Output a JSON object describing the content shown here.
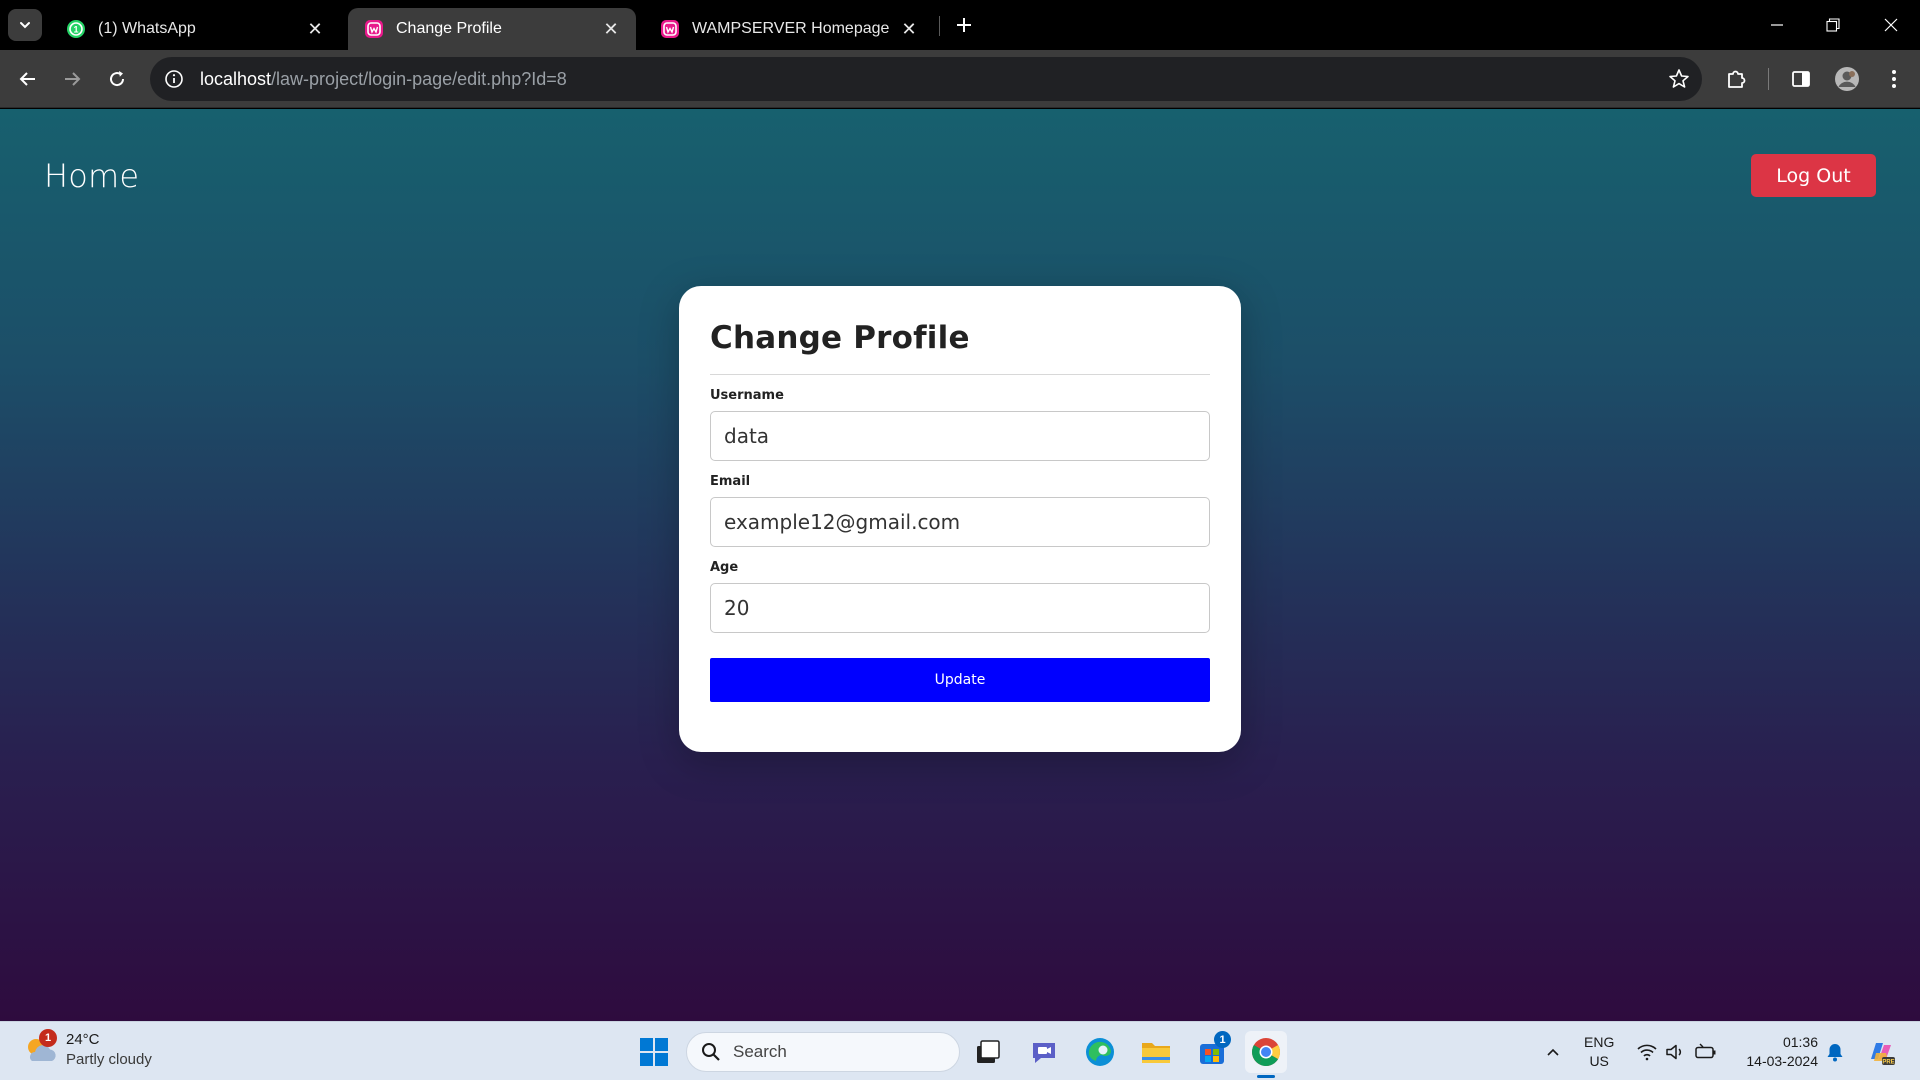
{
  "browser": {
    "tabs": [
      {
        "title": "(1) WhatsApp",
        "icon": "whatsapp-icon",
        "active": false
      },
      {
        "title": "Change Profile",
        "icon": "wamp-icon",
        "active": true
      },
      {
        "title": "WAMPSERVER Homepage",
        "icon": "wamp-icon",
        "active": false
      }
    ],
    "url_host": "localhost",
    "url_path": "/law-project/login-page/edit.php?Id=8"
  },
  "nav": {
    "home_label": "Home",
    "logout_label": "Log Out"
  },
  "form": {
    "title": "Change Profile",
    "username_label": "Username",
    "username_value": "data",
    "email_label": "Email",
    "email_value": "example12@gmail.com",
    "age_label": "Age",
    "age_value": "20",
    "submit_label": "Update"
  },
  "taskbar": {
    "weather_temp": "24°C",
    "weather_condition": "Partly cloudy",
    "weather_badge": "1",
    "search_placeholder": "Search",
    "store_badge": "1",
    "lang_primary": "ENG",
    "lang_secondary": "US",
    "time": "01:36",
    "date": "14-03-2024"
  },
  "colors": {
    "logout_bg": "#dc3545",
    "update_bg": "#0000ff",
    "gradient_top": "#17606e",
    "gradient_bottom": "#2e0b3e"
  }
}
